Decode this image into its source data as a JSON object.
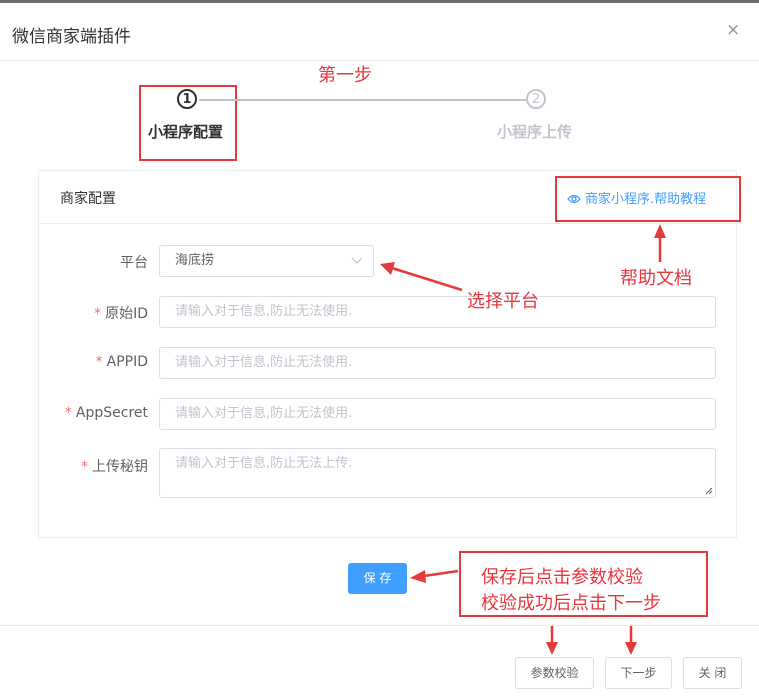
{
  "dialog": {
    "title": "微信商家端插件",
    "close_icon": "×"
  },
  "steps": {
    "annotation": "第一步",
    "items": [
      {
        "number": "1",
        "label": "小程序配置"
      },
      {
        "number": "2",
        "label": "小程序上传"
      }
    ]
  },
  "card": {
    "title": "商家配置",
    "help_link": "商家小程序.帮助教程"
  },
  "form": {
    "platform": {
      "label": "平台",
      "value": "海底捞"
    },
    "original_id": {
      "label": "原始ID",
      "placeholder": "请输入对于信息,防止无法使用."
    },
    "appid": {
      "label": "APPID",
      "placeholder": "请输入对于信息,防止无法使用."
    },
    "appsecret": {
      "label": "AppSecret",
      "placeholder": "请输入对于信息,防止无法使用."
    },
    "upload_key": {
      "label": "上传秘钥",
      "placeholder": "请输入对于信息,防止无法上传."
    },
    "required_mark": "*"
  },
  "buttons": {
    "save": "保 存",
    "verify": "参数校验",
    "next": "下一步",
    "close": "关 闭"
  },
  "annotations": {
    "help_doc": "帮助文档",
    "select_platform": "选择平台",
    "instruction_line1": "保存后点击参数校验",
    "instruction_line2": "校验成功后点击下一步"
  },
  "colors": {
    "primary": "#409eff",
    "annotation_red": "#e63a3a"
  }
}
